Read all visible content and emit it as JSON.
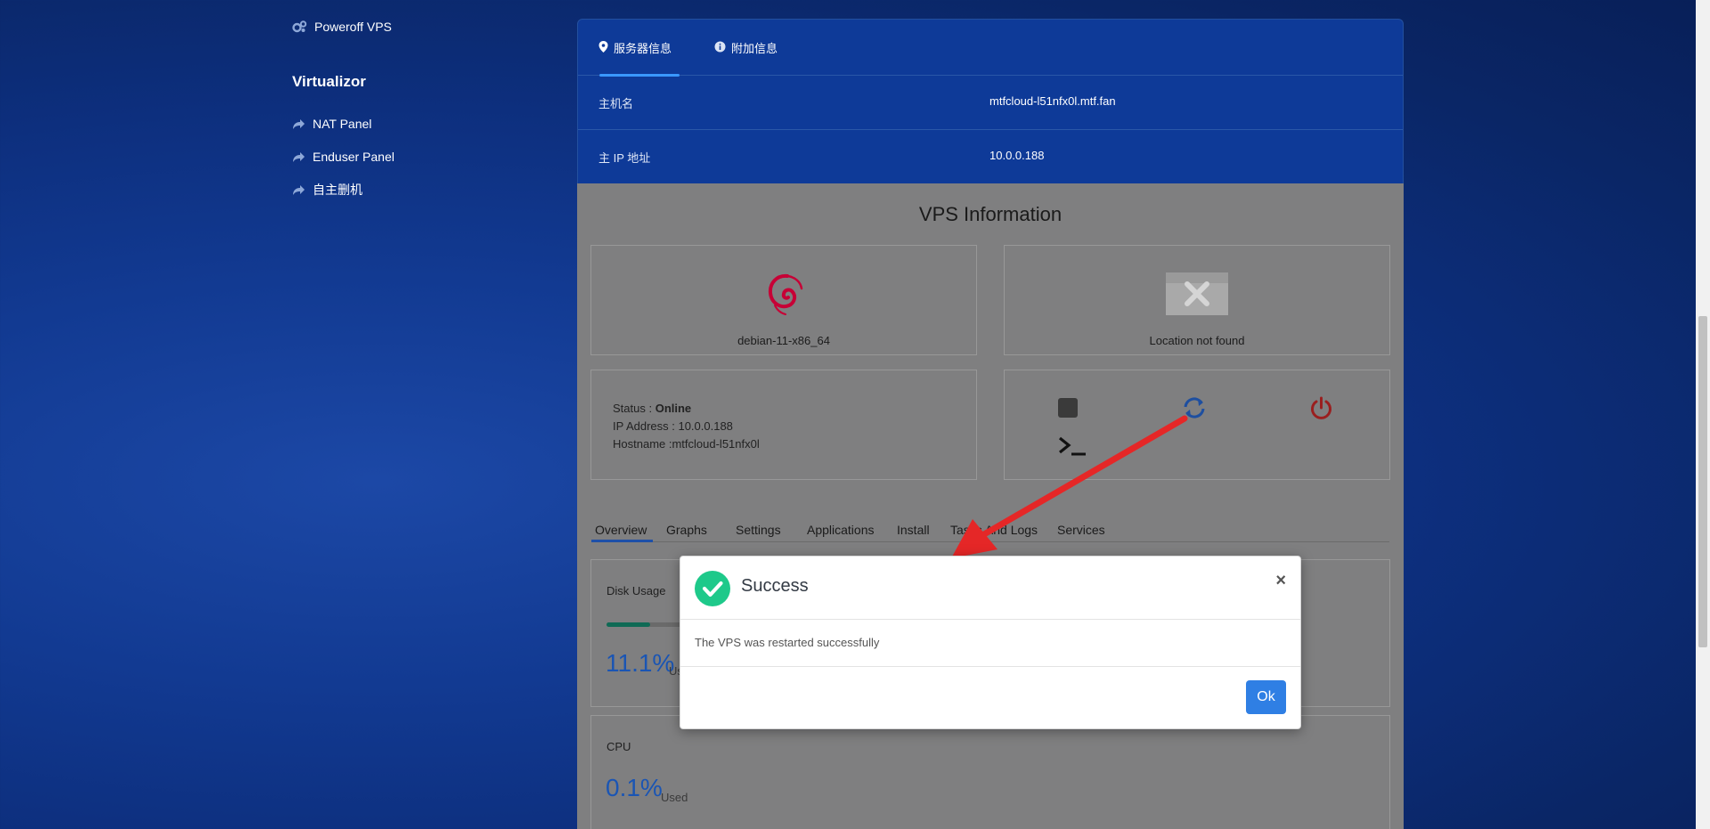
{
  "sidebar": {
    "items_top": [
      {
        "label": "Poweroff VPS",
        "icon": "gears-icon"
      }
    ],
    "heading": "Virtualizor",
    "items": [
      {
        "label": "NAT Panel",
        "icon": "share-arrow-icon"
      },
      {
        "label": "Enduser Panel",
        "icon": "share-arrow-icon"
      },
      {
        "label": "自主删机",
        "icon": "share-arrow-icon"
      }
    ]
  },
  "panel": {
    "tabs": [
      {
        "label": "服务器信息",
        "icon": "map-marker-icon",
        "active": true
      },
      {
        "label": "附加信息",
        "icon": "info-circle-icon",
        "active": false
      }
    ],
    "rows": [
      {
        "key": "主机名",
        "value": "mtfcloud-l51nfx0l.mtf.fan"
      },
      {
        "key": "主 IP 地址",
        "value": "10.0.0.188"
      }
    ]
  },
  "vps": {
    "title": "VPS Information",
    "os": "debian-11-x86_64",
    "location": "Location not found",
    "status_label": "Status : ",
    "status_value": "Online",
    "ip_line": "IP Address : 10.0.0.188",
    "hostname_line": "Hostname :mtfcloud-l51nfx0l",
    "controls": [
      "stop-icon",
      "restart-icon",
      "power-icon",
      "console-icon"
    ],
    "tabs": [
      "Overview",
      "Graphs",
      "Settings",
      "Applications",
      "Install",
      "Tasks And Logs",
      "Services"
    ],
    "disk_label": "Disk Usage",
    "disk_value": "11.1%",
    "disk_unit": "Us",
    "disk_fraction": 0.111,
    "cpu_label": "CPU",
    "cpu_value": "0.1%",
    "cpu_unit": "Used"
  },
  "modal": {
    "title": "Success",
    "message": "The VPS was restarted successfully",
    "ok_label": "Ok",
    "close_symbol": "×"
  },
  "colors": {
    "success": "#1ec98a",
    "ok_button": "#2f7fe4",
    "arrow": "#e52727",
    "debian": "#c70036",
    "tab_active": "#3a98ff"
  }
}
